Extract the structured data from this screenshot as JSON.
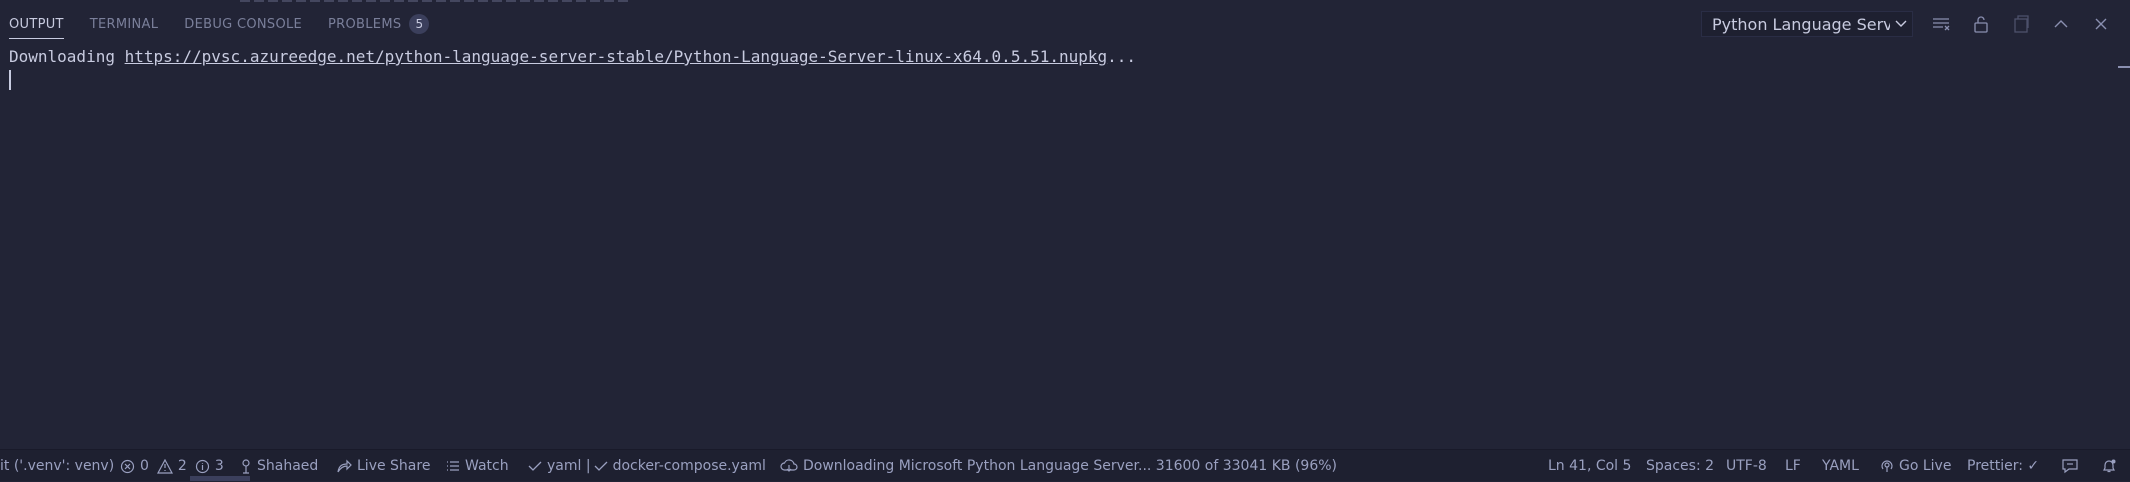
{
  "panel": {
    "tabs": [
      {
        "label": "OUTPUT"
      },
      {
        "label": "TERMINAL"
      },
      {
        "label": "DEBUG CONSOLE"
      },
      {
        "label": "PROBLEMS",
        "badge": "5"
      }
    ],
    "output_channel": "Python Language Serve",
    "icons": [
      "clear-output-icon",
      "lock-scroll-icon",
      "open-log-icon",
      "maximize-panel-icon",
      "close-panel-icon"
    ]
  },
  "output": {
    "line1_prefix": "Downloading ",
    "line1_url": "https://pvsc.azureedge.net/python-language-server-stable/Python-Language-Server-linux-x64.0.5.51.nupkg",
    "line1_suffix": "..."
  },
  "statusbar": {
    "interpreter": "it ('.venv': venv)",
    "errors": "0",
    "warnings": "2",
    "infos": "3",
    "user": "Shahaed",
    "live_share": "Live Share",
    "watch": "Watch",
    "yaml_check": "yaml | ",
    "compose_check": "docker-compose.yaml",
    "download_status": "Downloading Microsoft Python Language Server... 31600 of 33041 KB (96%)",
    "position": "Ln 41, Col 5",
    "spaces": "Spaces: 2",
    "encoding": "UTF-8",
    "eol": "LF",
    "language": "YAML",
    "go_live": "Go Live",
    "prettier": "Prettier: ✓"
  },
  "colors": {
    "background": "#222436",
    "statusbar": "#1e2030",
    "text": "#c8cbe0"
  }
}
